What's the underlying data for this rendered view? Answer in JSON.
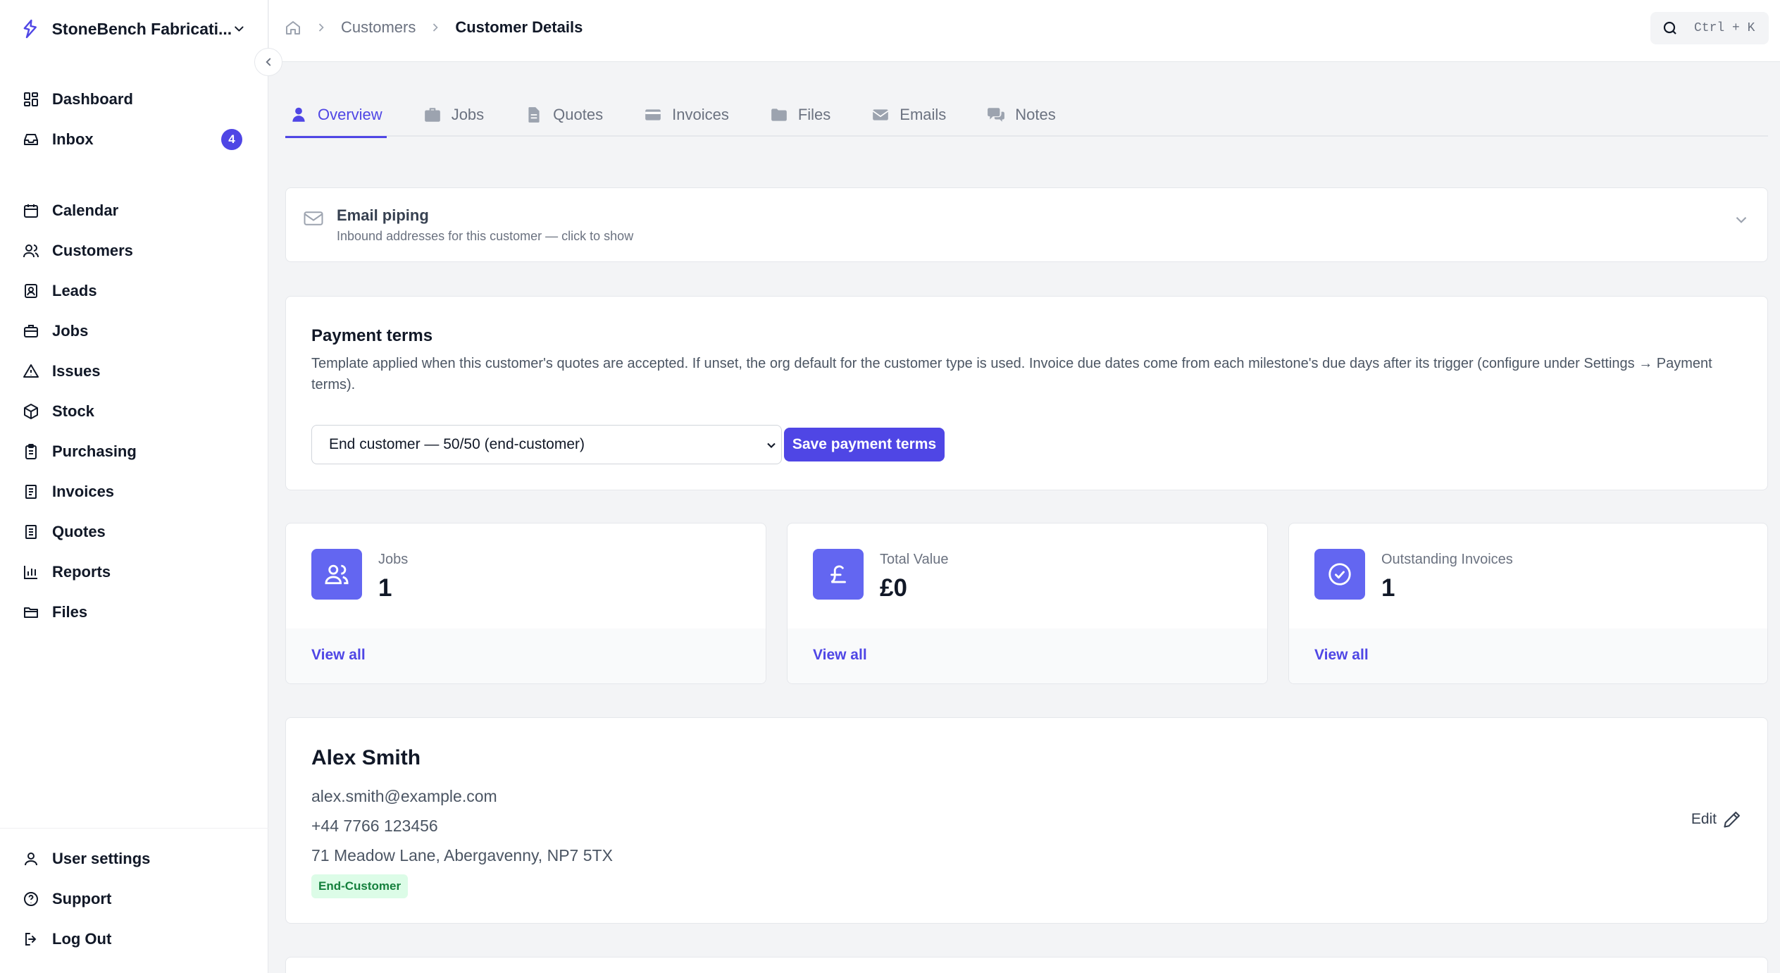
{
  "org": {
    "name": "StoneBench Fabricati..."
  },
  "nav": {
    "primary": [
      {
        "label": "Dashboard",
        "icon": "dashboard-icon"
      },
      {
        "label": "Inbox",
        "icon": "inbox-icon",
        "badge": "4"
      }
    ],
    "main": [
      {
        "label": "Calendar",
        "icon": "calendar-icon"
      },
      {
        "label": "Customers",
        "icon": "users-icon"
      },
      {
        "label": "Leads",
        "icon": "contact-card-icon"
      },
      {
        "label": "Jobs",
        "icon": "briefcase-icon"
      },
      {
        "label": "Issues",
        "icon": "warning-icon"
      },
      {
        "label": "Stock",
        "icon": "box-icon"
      },
      {
        "label": "Purchasing",
        "icon": "clipboard-icon"
      },
      {
        "label": "Invoices",
        "icon": "receipt-icon"
      },
      {
        "label": "Quotes",
        "icon": "quote-doc-icon"
      },
      {
        "label": "Reports",
        "icon": "bar-chart-icon"
      },
      {
        "label": "Files",
        "icon": "folder-icon"
      }
    ],
    "bottom": [
      {
        "label": "User settings",
        "icon": "user-icon"
      },
      {
        "label": "Support",
        "icon": "help-icon"
      },
      {
        "label": "Log Out",
        "icon": "logout-icon"
      }
    ]
  },
  "breadcrumb": {
    "level1": "Customers",
    "level2": "Customer Details"
  },
  "search": {
    "shortcut": "Ctrl + K"
  },
  "tabs": [
    {
      "label": "Overview",
      "active": true
    },
    {
      "label": "Jobs"
    },
    {
      "label": "Quotes"
    },
    {
      "label": "Invoices"
    },
    {
      "label": "Files"
    },
    {
      "label": "Emails"
    },
    {
      "label": "Notes"
    }
  ],
  "email_piping": {
    "title": "Email piping",
    "subtitle": "Inbound addresses for this customer — click to show"
  },
  "payment_terms": {
    "title": "Payment terms",
    "description": "Template applied when this customer's quotes are accepted. If unset, the org default for the customer type is used. Invoice due dates come from each milestone's due days after its trigger (configure under Settings → Payment terms).",
    "selected": "End customer — 50/50 (end-customer)",
    "save_label": "Save payment terms"
  },
  "stats": [
    {
      "label": "Jobs",
      "value": "1",
      "link": "View all",
      "icon": "users-icon"
    },
    {
      "label": "Total Value",
      "value": "£0",
      "link": "View all",
      "icon": "pound-icon"
    },
    {
      "label": "Outstanding Invoices",
      "value": "1",
      "link": "View all",
      "icon": "check-circle-icon"
    }
  ],
  "customer": {
    "name": "Alex Smith",
    "email": "alex.smith@example.com",
    "phone": "+44 7766 123456",
    "address": "71 Meadow Lane, Abergavenny, NP7 5TX",
    "tag": "End-Customer",
    "edit_label": "Edit"
  },
  "colors": {
    "accent": "#4f46e5",
    "stat_icon_bg": "#6366f1",
    "tag_bg": "#dcfce7",
    "tag_text": "#15803d"
  }
}
